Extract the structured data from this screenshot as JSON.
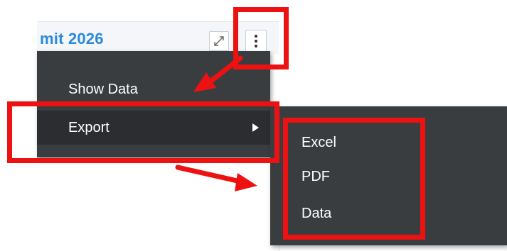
{
  "widget": {
    "title": "mit 2026"
  },
  "menu": {
    "items": [
      {
        "label": "Show Data"
      },
      {
        "label": "Export"
      }
    ]
  },
  "export_submenu": {
    "items": [
      {
        "label": "Excel"
      },
      {
        "label": "PDF"
      },
      {
        "label": "Data"
      }
    ]
  },
  "background": {
    "partial_text": "????"
  },
  "colors": {
    "menu_bg": "#3a3d40",
    "menu_hover_bg": "#2b2d30",
    "highlight": "#ee1111",
    "title": "#2a8ad8"
  },
  "icons": {
    "expand": "expand-icon",
    "more": "vertical-ellipsis-icon",
    "submenu": "caret-right-icon"
  }
}
